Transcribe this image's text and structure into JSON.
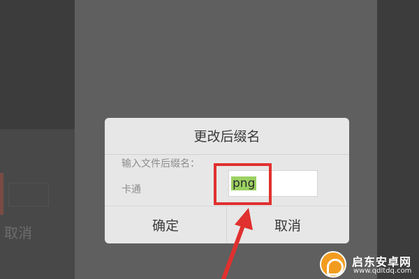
{
  "background": {
    "left_panel": {
      "cancel_label": "取消"
    }
  },
  "dialog": {
    "title": "更改后缀名",
    "prompt_label": "输入文件后缀名：",
    "file_name": "卡通",
    "extension_value": "png",
    "ok_label": "确定",
    "cancel_label": "取消"
  },
  "annotation": {
    "highlight_color": "#e0312f"
  },
  "watermark": {
    "name": "启东安卓网",
    "url": "www.qdltdq.com"
  },
  "colors": {
    "selection_highlight": "#9bd162",
    "dialog_background": "#e7e7e7",
    "watermark_badge": "#f29c1f"
  }
}
